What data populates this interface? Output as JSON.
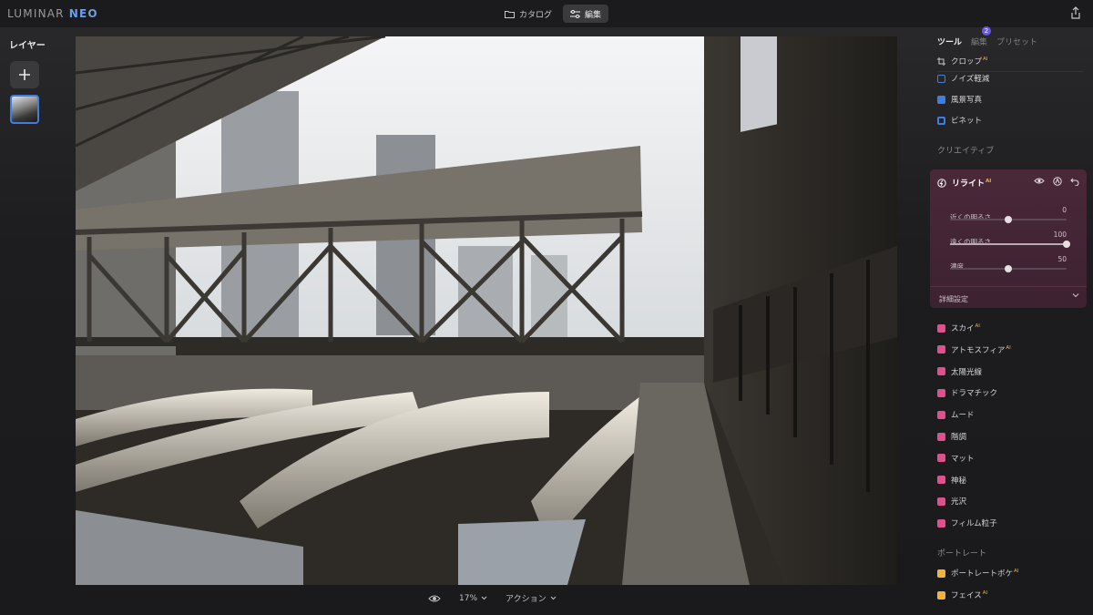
{
  "app": {
    "logo_a": "LUMINAR ",
    "logo_b": "NEO"
  },
  "topnav": {
    "catalog": "カタログ",
    "edit": "編集"
  },
  "layers": {
    "title": "レイヤー"
  },
  "bottom": {
    "zoom": "17%",
    "action": "アクション"
  },
  "panel": {
    "tabs": {
      "tools": "ツール",
      "edits": "編集",
      "edits_badge": "2",
      "presets": "プリセット"
    },
    "top_tools": [
      {
        "label": "クロップ",
        "ai": "AI",
        "icon": "crop-icon",
        "color": "#c9c9cc"
      },
      {
        "label": "ノイズ軽減",
        "icon": "noise-icon",
        "color": "#3f7de0"
      },
      {
        "label": "風景写真",
        "icon": "landscape-icon",
        "color": "#3f7de0"
      },
      {
        "label": "ビネット",
        "icon": "vignette-icon",
        "color": "#3f7de0"
      }
    ],
    "creative_title": "クリエイティブ",
    "relight": {
      "label": "リライト",
      "ai": "AI",
      "sliders": [
        {
          "label": "近くの明るさ",
          "value": "0",
          "pos": 0.5
        },
        {
          "label": "遠くの明るさ",
          "value": "100",
          "pos": 1.0
        },
        {
          "label": "濃度",
          "value": "50",
          "pos": 0.5
        }
      ],
      "advanced": "詳細設定"
    },
    "creative_tools": [
      {
        "label": "スカイ",
        "ai": "AI",
        "icon": "cloud-icon",
        "color": "#e0508c"
      },
      {
        "label": "アトモスフィア",
        "ai": "AI",
        "icon": "atmosphere-icon",
        "color": "#e0508c"
      },
      {
        "label": "太陽光線",
        "icon": "sun-rays-icon",
        "color": "#e0508c"
      },
      {
        "label": "ドラマチック",
        "icon": "lightning-icon",
        "color": "#e0508c"
      },
      {
        "label": "ムード",
        "icon": "mood-icon",
        "color": "#e0508c"
      },
      {
        "label": "階調",
        "icon": "toning-icon",
        "color": "#e0508c"
      },
      {
        "label": "マット",
        "icon": "matte-icon",
        "color": "#e0508c"
      },
      {
        "label": "神秘",
        "icon": "mystical-icon",
        "color": "#e0508c"
      },
      {
        "label": "光沢",
        "icon": "glow-icon",
        "color": "#e0508c"
      },
      {
        "label": "フィルム粒子",
        "icon": "film-grain-icon",
        "color": "#e0508c"
      }
    ],
    "portrait_title": "ポートレート",
    "portrait_tools": [
      {
        "label": "ポートレートボケ",
        "ai": "AI",
        "icon": "portrait-bokeh-icon",
        "color": "#f0b43c"
      },
      {
        "label": "フェイス",
        "ai": "AI",
        "icon": "face-icon",
        "color": "#f0b43c"
      }
    ]
  }
}
